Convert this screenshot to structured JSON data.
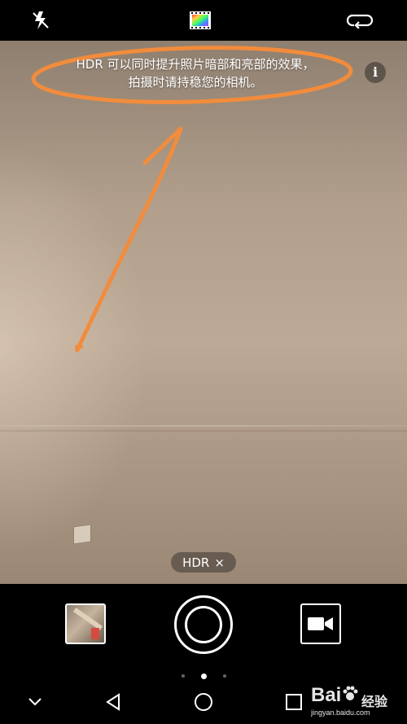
{
  "top_bar": {
    "flash_icon": "flash-auto-off-icon",
    "filter_icon": "color-filter-icon",
    "switch_icon": "switch-camera-icon"
  },
  "viewfinder": {
    "hint_line1": "HDR 可以同时提升照片暗部和亮部的效果，",
    "hint_line2": "拍摄时请持稳您的相机。",
    "info_label": "i",
    "annotation_color": "#F28C3C"
  },
  "mode_chip": {
    "label": "HDR",
    "close_symbol": "×"
  },
  "controls": {
    "gallery_icon": "gallery-thumbnail",
    "shutter_icon": "shutter-button",
    "video_icon": "video-camera-icon",
    "page_dots": 3,
    "active_dot": 1
  },
  "nav_bar": {
    "down_icon": "chevron-down-icon",
    "back_icon": "back-triangle-icon",
    "home_icon": "home-circle-icon",
    "recent_icon": "recent-square-icon"
  },
  "watermark": {
    "logo": "Bai",
    "logo_suffix": "du",
    "cn": "经验",
    "url": "jingyan.baidu.com"
  }
}
